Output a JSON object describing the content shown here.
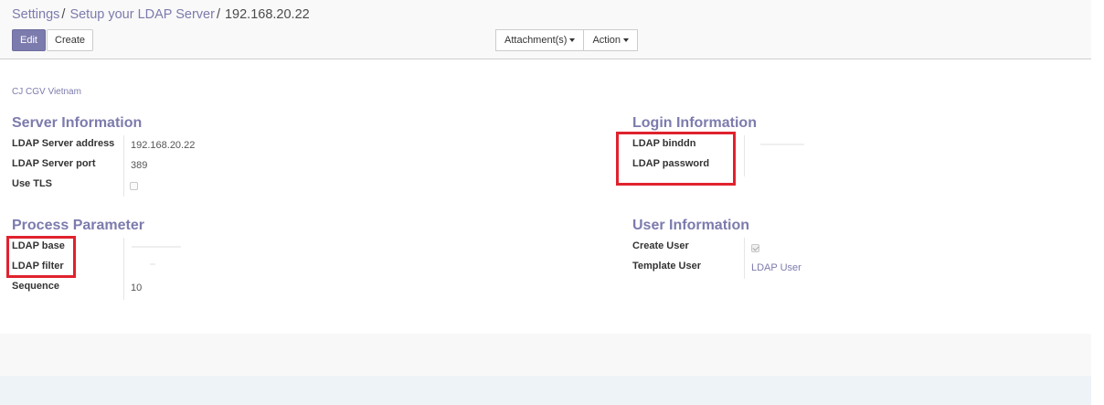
{
  "breadcrumb": {
    "items": [
      "Settings",
      "Setup your LDAP Server"
    ],
    "separator": "/",
    "current": "192.168.20.22"
  },
  "toolbar": {
    "edit_label": "Edit",
    "create_label": "Create",
    "attachments_label": "Attachment(s)",
    "action_label": "Action"
  },
  "company": "CJ CGV Vietnam",
  "server_info": {
    "title": "Server Information",
    "address_label": "LDAP Server address",
    "address_value": "192.168.20.22",
    "port_label": "LDAP Server port",
    "port_value": "389",
    "tls_label": "Use TLS",
    "tls_checked": false
  },
  "login_info": {
    "title": "Login Information",
    "binddn_label": "LDAP binddn",
    "password_label": "LDAP password"
  },
  "process_param": {
    "title": "Process Parameter",
    "base_label": "LDAP base",
    "filter_label": "LDAP filter",
    "sequence_label": "Sequence",
    "sequence_value": "10"
  },
  "user_info": {
    "title": "User Information",
    "create_user_label": "Create User",
    "create_user_checked": true,
    "template_user_label": "Template User",
    "template_user_value": "LDAP User"
  },
  "colors": {
    "accent": "#7c7bad",
    "highlight": "#e0222e"
  },
  "icons": {
    "dropdown": "caret-down-icon",
    "checkbox": "checkbox-icon"
  }
}
